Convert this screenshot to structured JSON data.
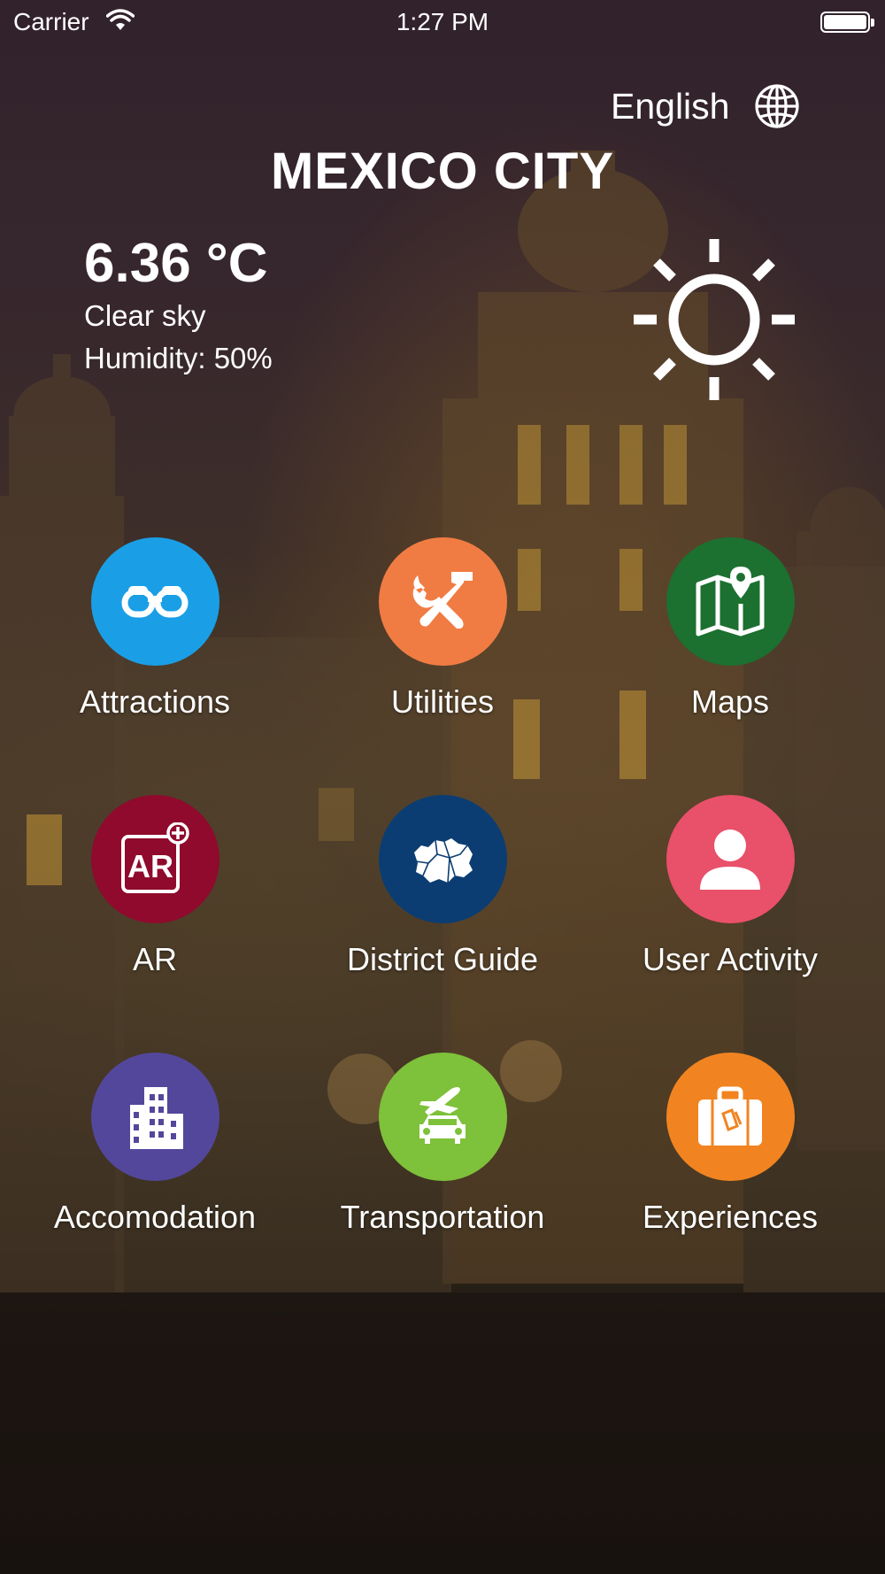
{
  "status_bar": {
    "carrier": "Carrier",
    "time": "1:27 PM"
  },
  "header": {
    "language": "English",
    "city": "MEXICO CITY"
  },
  "weather": {
    "temperature": "6.36 °C",
    "description": "Clear sky",
    "humidity": "Humidity: 50%",
    "icon": "sun-icon"
  },
  "menu": [
    {
      "label": "Attractions",
      "icon": "binoculars-icon",
      "color": "#1a9fe6"
    },
    {
      "label": "Utilities",
      "icon": "tools-icon",
      "color": "#f07c43"
    },
    {
      "label": "Maps",
      "icon": "map-icon",
      "color": "#1c7030"
    },
    {
      "label": "AR",
      "icon": "ar-icon",
      "color": "#8f0a2c"
    },
    {
      "label": "District Guide",
      "icon": "district-map-icon",
      "color": "#0b3d72"
    },
    {
      "label": "User Activity",
      "icon": "user-icon",
      "color": "#e9506a"
    },
    {
      "label": "Accomodation",
      "icon": "building-icon",
      "color": "#53479c"
    },
    {
      "label": "Transportation",
      "icon": "transport-icon",
      "color": "#7ec13a"
    },
    {
      "label": "Experiences",
      "icon": "suitcase-icon",
      "color": "#f18421"
    }
  ]
}
